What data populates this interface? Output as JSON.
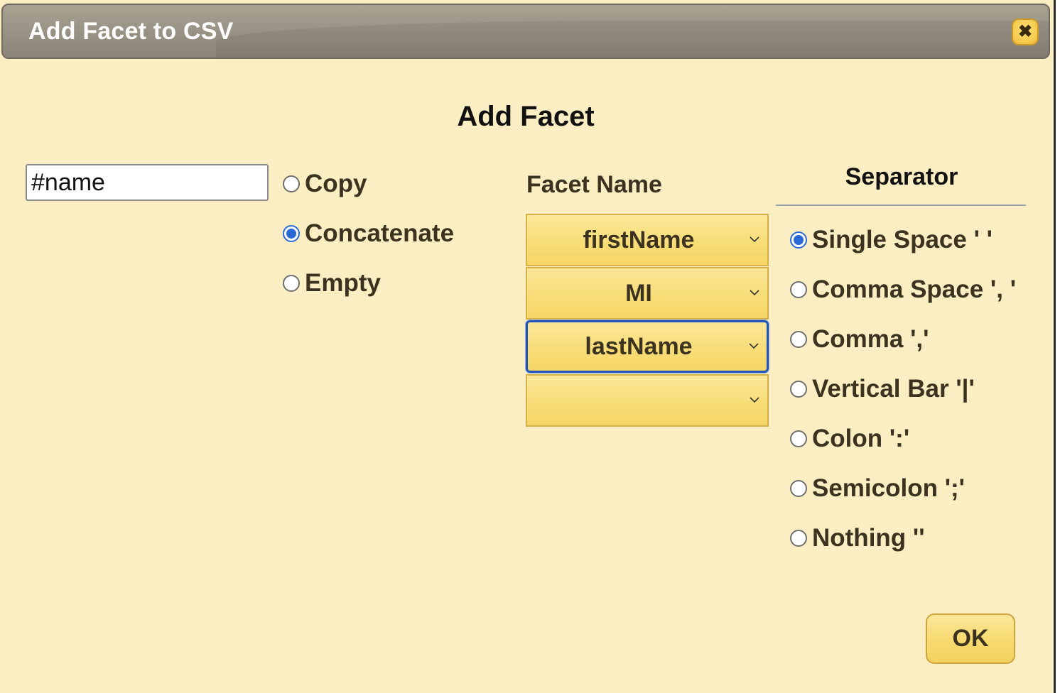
{
  "dialog": {
    "title": "Add Facet to CSV",
    "close_icon": "close-icon",
    "heading": "Add Facet",
    "name_input": {
      "value": "#name"
    },
    "modes": [
      {
        "label": "Copy",
        "checked": false
      },
      {
        "label": "Concatenate",
        "checked": true
      },
      {
        "label": "Empty",
        "checked": false
      }
    ],
    "facet_name": {
      "header": "Facet Name",
      "selects": [
        {
          "value": "firstName",
          "focused": false
        },
        {
          "value": "MI",
          "focused": false
        },
        {
          "value": "lastName",
          "focused": true
        },
        {
          "value": "",
          "focused": false
        }
      ]
    },
    "separator": {
      "header": "Separator",
      "options": [
        {
          "label": "Single Space ' '",
          "checked": true
        },
        {
          "label": "Comma Space ', '",
          "checked": false
        },
        {
          "label": "Comma ','",
          "checked": false
        },
        {
          "label": "Vertical Bar '|'",
          "checked": false
        },
        {
          "label": "Colon ':'",
          "checked": false
        },
        {
          "label": "Semicolon ';'",
          "checked": false
        },
        {
          "label": "Nothing ''",
          "checked": false
        }
      ]
    },
    "ok_label": "OK"
  },
  "colors": {
    "dialog_bg": "#fbeec3",
    "titlebar": "#9a9486",
    "select_fill": "#f8dd77",
    "radio_selected": "#2a6ad8",
    "focus_border": "#1f55b8"
  }
}
